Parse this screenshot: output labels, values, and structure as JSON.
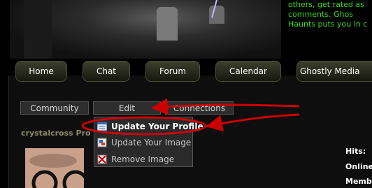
{
  "promo": {
    "lines": [
      "others, get rated as",
      "comments.    Ghos",
      "Haunts puts you in c"
    ]
  },
  "nav": {
    "items": [
      "Home",
      "Chat",
      "Forum",
      "Calendar",
      "Ghostly Media"
    ]
  },
  "subtabs": {
    "community": "Community",
    "edit": "Edit",
    "connections": "Connections"
  },
  "profile": {
    "username": "crystalcross Pro"
  },
  "edit_menu": {
    "items": [
      "Update Your Profile",
      "Update Your Image",
      "Remove Image"
    ]
  },
  "stats": {
    "hits": "Hits:",
    "online": "Online",
    "member": "Memb"
  },
  "colors": {
    "annotation": "#cc0000",
    "promo_text": "#33dd11"
  },
  "icons": [
    "profile-card-icon",
    "image-icon",
    "remove-x-icon"
  ]
}
